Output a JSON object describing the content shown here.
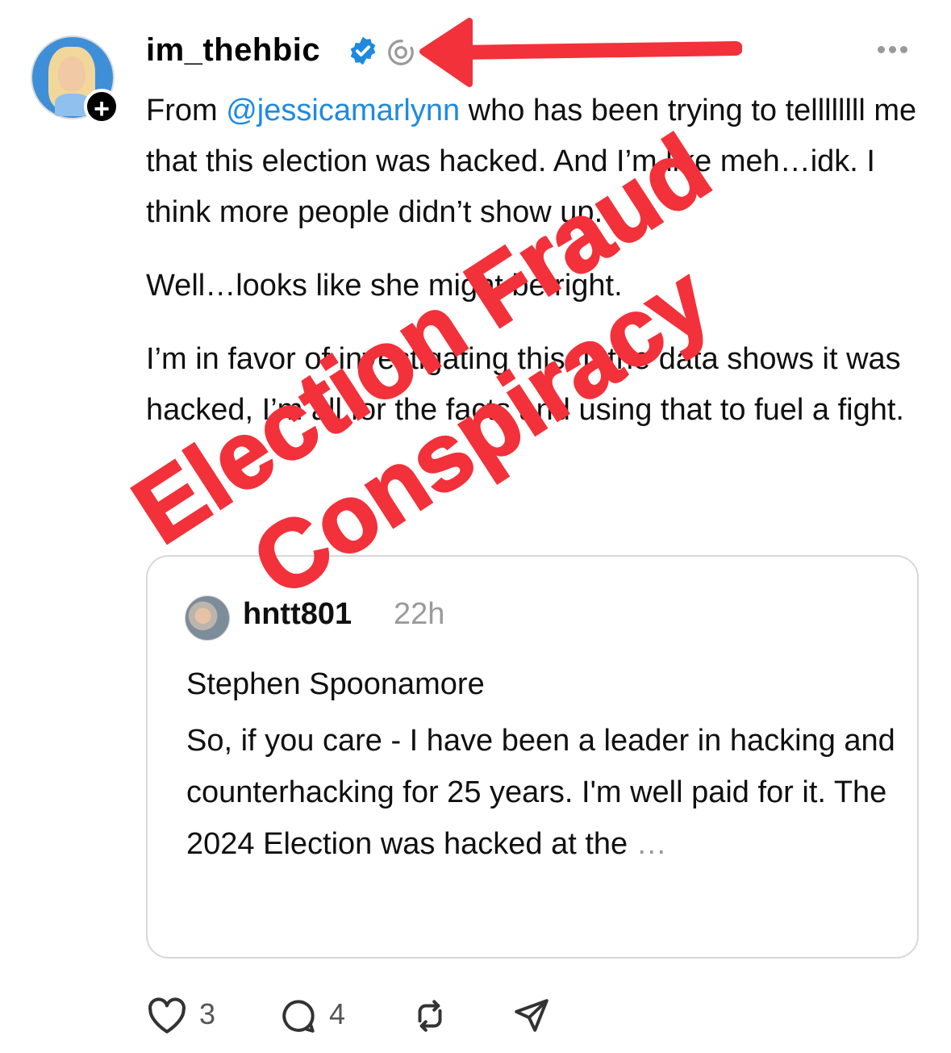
{
  "post": {
    "username": "im_thehbic",
    "paragraphs": [
      {
        "mention": "@jessicamarlynn",
        "before": "From ",
        "after": " who has been trying to tellllllll me that this election was hacked. And I’m like meh…idk. I think more people didn’t show up."
      },
      {
        "text": "Well…looks like she might be right."
      },
      {
        "text": "I’m in favor of investigating this. If the data shows it was hacked, I’m all for the facts and using that to fuel a fight."
      }
    ]
  },
  "quote": {
    "username": "hntt801",
    "time": "22h",
    "author_line": "Stephen Spoonamore",
    "body": "So, if you care - I have been a leader in hacking and counterhacking for 25 years. I'm well paid for it.  The 2024 Election was hacked at the",
    "ellipsis": " …"
  },
  "actions": {
    "like_count": "3",
    "reply_count": "4"
  },
  "overlay": {
    "line1": "Election Fraud",
    "line2": "Conspiracy",
    "color": "#f2313a"
  },
  "icons": [
    "plus-icon",
    "verified-badge-icon",
    "threads-icon",
    "more-icon",
    "heart-icon",
    "comment-icon",
    "repost-icon",
    "share-icon",
    "arrow-annotation"
  ]
}
